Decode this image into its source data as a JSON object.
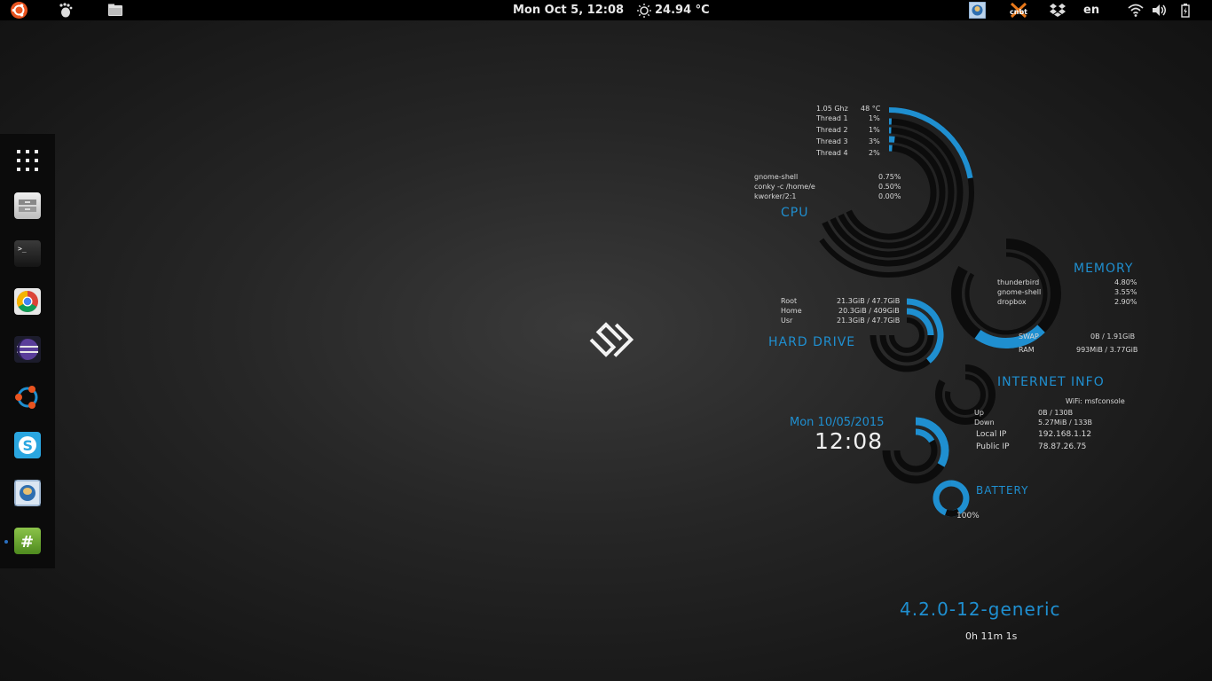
{
  "topbar": {
    "datetime": "Mon Oct  5, 12:08",
    "weather": "24.94 °C",
    "indicator_label": "cnbt",
    "language": "en"
  },
  "desktop": {
    "cpu": {
      "title": "CPU",
      "freq": "1.05 Ghz",
      "temp": "48 °C",
      "threads": [
        {
          "label": "Thread 1",
          "value": "1%"
        },
        {
          "label": "Thread 2",
          "value": "1%"
        },
        {
          "label": "Thread 3",
          "value": "3%"
        },
        {
          "label": "Thread 4",
          "value": "2%"
        }
      ],
      "processes": [
        {
          "name": "gnome-shell",
          "value": "0.75%"
        },
        {
          "name": "conky -c /home/e",
          "value": "0.50%"
        },
        {
          "name": "kworker/2:1",
          "value": "0.00%"
        }
      ]
    },
    "memory": {
      "title": "MEMORY",
      "processes": [
        {
          "name": "thunderbird",
          "value": "4.80%"
        },
        {
          "name": "gnome-shell",
          "value": "3.55%"
        },
        {
          "name": "dropbox",
          "value": "2.90%"
        }
      ],
      "swap_label": "SWAP",
      "swap_value": "0B  / 1.91GiB",
      "ram_label": "RAM",
      "ram_value": "993MiB / 3.77GiB"
    },
    "hdd": {
      "title": "HARD DRIVE",
      "drives": [
        {
          "name": "Root",
          "value": "21.3GiB / 47.7GiB"
        },
        {
          "name": "Home",
          "value": "20.3GiB / 409GiB"
        },
        {
          "name": "Usr",
          "value": "21.3GiB / 47.7GiB"
        }
      ]
    },
    "net": {
      "title": "INTERNET INFO",
      "wifi": "WiFi: msfconsole",
      "up_label": "Up",
      "up_value": "0B  / 130B",
      "down_label": "Down",
      "down_value": "5.27MiB / 133B",
      "local_label": "Local IP",
      "local_value": "192.168.1.12",
      "public_label": "Public IP",
      "public_value": "78.87.26.75"
    },
    "clock": {
      "date": "Mon 10/05/2015",
      "time": "12:08"
    },
    "battery": {
      "title": "BATTERY",
      "value": "100%"
    },
    "kernel": "4.2.0-12-generic",
    "uptime": "0h 11m 1s"
  },
  "colors": {
    "accent": "#1f8fd0",
    "ring_dark": "#0c0c0c"
  }
}
